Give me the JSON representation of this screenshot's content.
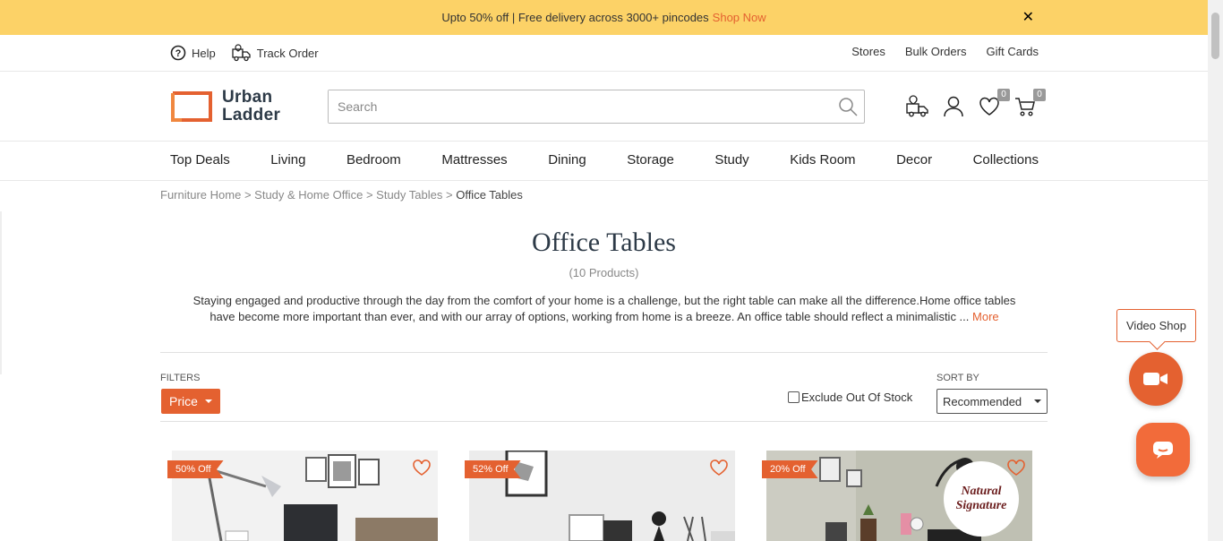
{
  "announcement": {
    "text": "Upto 50% off | Free delivery across 3000+ pincodes",
    "cta": "Shop Now",
    "close_icon": "close-icon"
  },
  "utility_bar": {
    "left": [
      {
        "label": "Help",
        "icon": "help-circle-icon"
      },
      {
        "label": "Track Order",
        "icon": "truck-icon"
      }
    ],
    "right": [
      "Stores",
      "Bulk Orders",
      "Gift Cards"
    ]
  },
  "header": {
    "logo_line1": "Urban",
    "logo_line2": "Ladder",
    "search_placeholder": "Search",
    "wishlist_count": "0",
    "cart_count": "0"
  },
  "nav": [
    "Top Deals",
    "Living",
    "Bedroom",
    "Mattresses",
    "Dining",
    "Storage",
    "Study",
    "Kids Room",
    "Decor",
    "Collections"
  ],
  "breadcrumb": {
    "items": [
      "Furniture Home",
      "Study & Home Office",
      "Study Tables"
    ],
    "sep": ">",
    "current": "Office Tables"
  },
  "page": {
    "title": "Office Tables",
    "count": "(10 Products)",
    "desc1": "Staying engaged and productive through the day from the comfort of your home is a challenge, but the right table can make all the difference.Home office tables",
    "desc2": "have become more important than ever, and with our array of options, working from home is a breeze. An office table should reflect a minimalistic ...",
    "more": "More"
  },
  "filters": {
    "label": "FILTERS",
    "price": "Price",
    "exclude_label": "Exclude Out Of Stock"
  },
  "sort": {
    "label": "SORT BY",
    "value": "Recommended"
  },
  "products": [
    {
      "discount": "50% Off"
    },
    {
      "discount": "52% Off"
    },
    {
      "discount": "20% Off",
      "badge_line1": "Natural",
      "badge_line2": "Signature"
    }
  ],
  "widgets": {
    "video_shop": "Video Shop"
  },
  "colors": {
    "accent": "#e46130",
    "banner": "#fcd267",
    "text_dark": "#2d3a47"
  }
}
